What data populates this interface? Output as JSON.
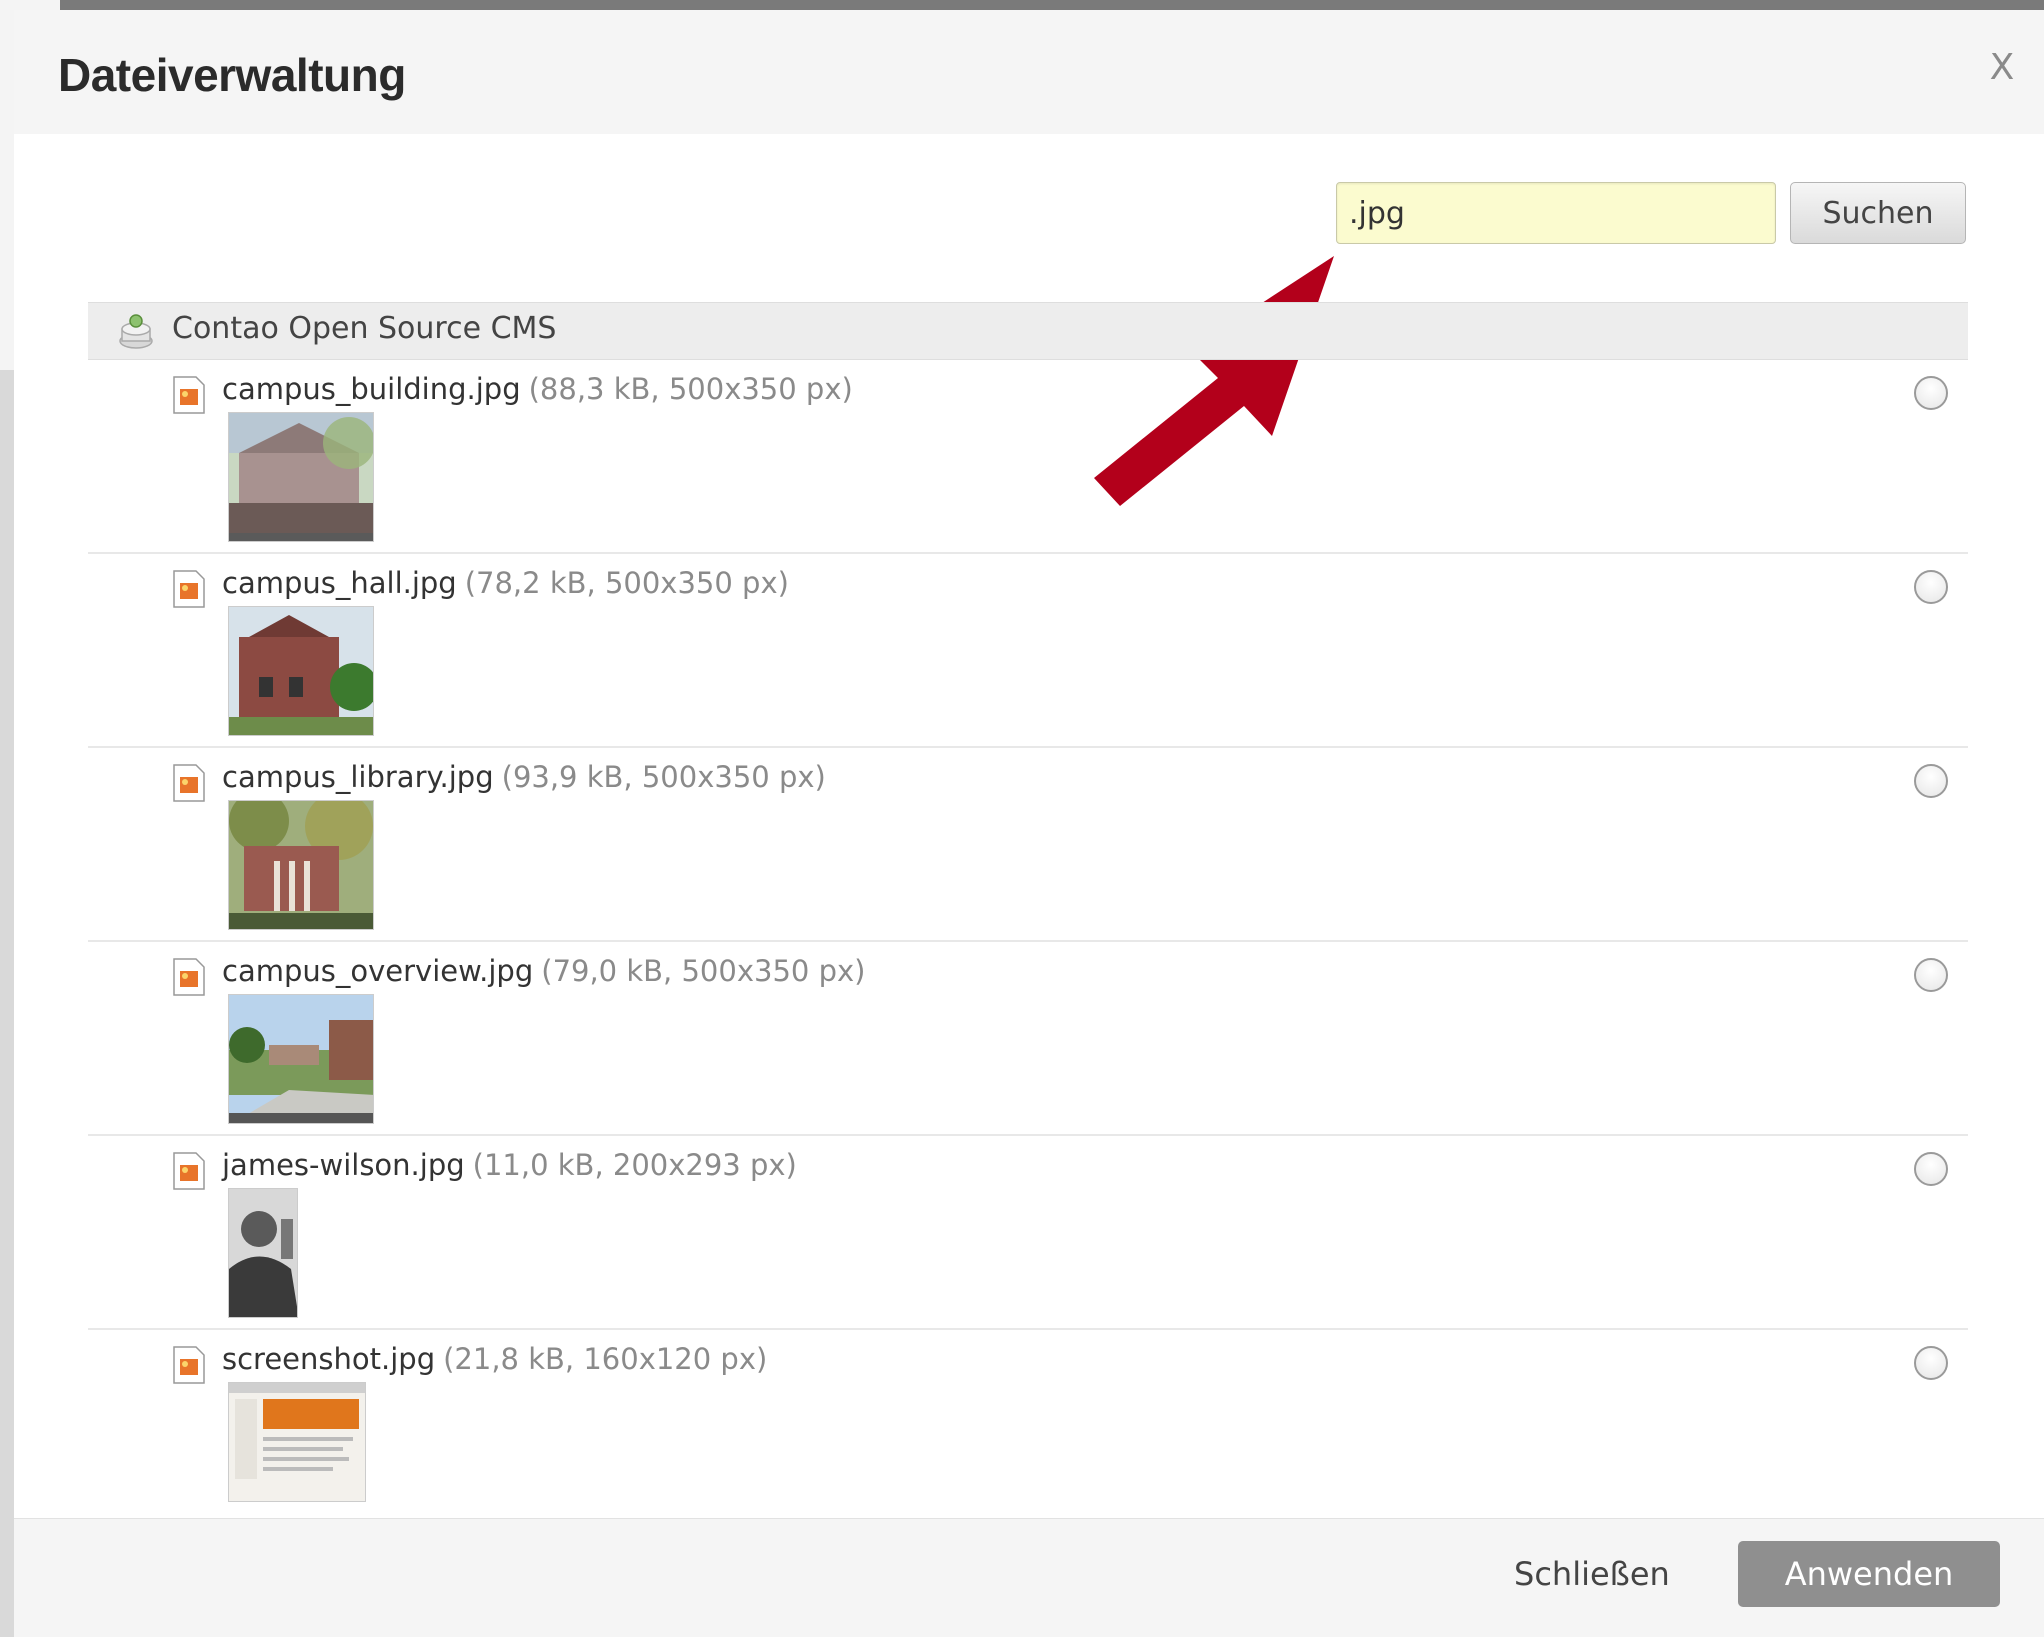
{
  "modal": {
    "title": "Dateiverwaltung",
    "close_symbol": "X"
  },
  "search": {
    "value": ".jpg",
    "button_label": "Suchen"
  },
  "tree": {
    "root_label": "Contao Open Source CMS",
    "root_icon": "filemount-icon"
  },
  "files": [
    {
      "name": "campus_building.jpg",
      "meta": "(88,3 kB, 500x350 px)",
      "icon": "image-file-icon"
    },
    {
      "name": "campus_hall.jpg",
      "meta": "(78,2 kB, 500x350 px)",
      "icon": "image-file-icon"
    },
    {
      "name": "campus_library.jpg",
      "meta": "(93,9 kB, 500x350 px)",
      "icon": "image-file-icon"
    },
    {
      "name": "campus_overview.jpg",
      "meta": "(79,0 kB, 500x350 px)",
      "icon": "image-file-icon"
    },
    {
      "name": "james-wilson.jpg",
      "meta": "(11,0 kB, 200x293 px)",
      "icon": "image-file-icon"
    },
    {
      "name": "screenshot.jpg",
      "meta": "(21,8 kB, 160x120 px)",
      "icon": "image-file-icon"
    }
  ],
  "footer": {
    "close_label": "Schließen",
    "apply_label": "Anwenden"
  },
  "colors": {
    "arrow": "#b3001b",
    "search_bg": "#fbfbcf",
    "apply_bg": "#8f8f8f"
  }
}
